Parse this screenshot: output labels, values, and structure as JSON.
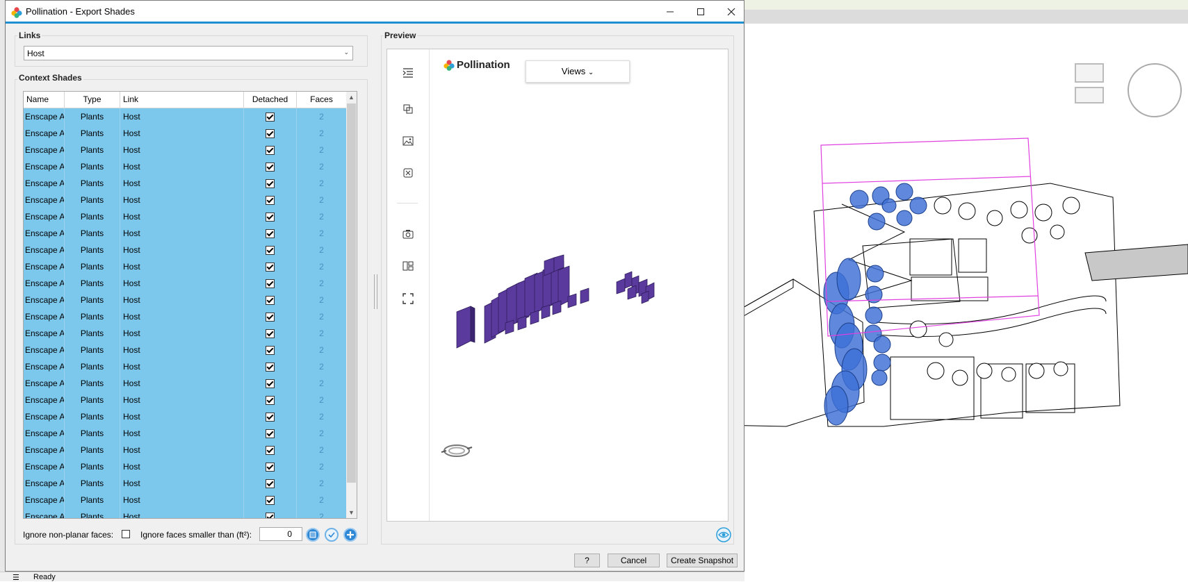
{
  "dialog": {
    "title": "Pollination - Export Shades"
  },
  "links": {
    "legend": "Links",
    "selected": "Host"
  },
  "context": {
    "legend": "Context Shades",
    "columns": [
      "Name",
      "Type",
      "Link",
      "Detached",
      "Faces"
    ],
    "rows": [
      {
        "name": "Enscape A",
        "type": "Plants",
        "link": "Host",
        "faces": "2"
      },
      {
        "name": "Enscape A",
        "type": "Plants",
        "link": "Host",
        "faces": "2"
      },
      {
        "name": "Enscape A",
        "type": "Plants",
        "link": "Host",
        "faces": "2"
      },
      {
        "name": "Enscape A",
        "type": "Plants",
        "link": "Host",
        "faces": "2"
      },
      {
        "name": "Enscape A",
        "type": "Plants",
        "link": "Host",
        "faces": "2"
      },
      {
        "name": "Enscape A",
        "type": "Plants",
        "link": "Host",
        "faces": "2"
      },
      {
        "name": "Enscape A",
        "type": "Plants",
        "link": "Host",
        "faces": "2"
      },
      {
        "name": "Enscape A",
        "type": "Plants",
        "link": "Host",
        "faces": "2"
      },
      {
        "name": "Enscape A",
        "type": "Plants",
        "link": "Host",
        "faces": "2"
      },
      {
        "name": "Enscape A",
        "type": "Plants",
        "link": "Host",
        "faces": "2"
      },
      {
        "name": "Enscape A",
        "type": "Plants",
        "link": "Host",
        "faces": "2"
      },
      {
        "name": "Enscape A",
        "type": "Plants",
        "link": "Host",
        "faces": "2"
      },
      {
        "name": "Enscape A",
        "type": "Plants",
        "link": "Host",
        "faces": "2"
      },
      {
        "name": "Enscape A",
        "type": "Plants",
        "link": "Host",
        "faces": "2"
      },
      {
        "name": "Enscape A",
        "type": "Plants",
        "link": "Host",
        "faces": "2"
      },
      {
        "name": "Enscape A",
        "type": "Plants",
        "link": "Host",
        "faces": "2"
      },
      {
        "name": "Enscape A",
        "type": "Plants",
        "link": "Host",
        "faces": "2"
      },
      {
        "name": "Enscape A",
        "type": "Plants",
        "link": "Host",
        "faces": "2"
      },
      {
        "name": "Enscape A",
        "type": "Plants",
        "link": "Host",
        "faces": "2"
      },
      {
        "name": "Enscape A",
        "type": "Plants",
        "link": "Host",
        "faces": "2"
      },
      {
        "name": "Enscape A",
        "type": "Plants",
        "link": "Host",
        "faces": "2"
      },
      {
        "name": "Enscape A",
        "type": "Plants",
        "link": "Host",
        "faces": "2"
      },
      {
        "name": "Enscape A",
        "type": "Plants",
        "link": "Host",
        "faces": "2"
      },
      {
        "name": "Enscape A",
        "type": "Plants",
        "link": "Host",
        "faces": "2"
      },
      {
        "name": "Enscape A",
        "type": "Plants",
        "link": "Host",
        "faces": "2"
      }
    ],
    "ignore_nonplanar_label": "Ignore non-planar faces:",
    "ignore_smaller_label": "Ignore faces smaller than (ft²):",
    "ignore_smaller_value": "0"
  },
  "preview": {
    "legend": "Preview",
    "brand": "Pollination",
    "views_label": "Views"
  },
  "buttons": {
    "help": "?",
    "cancel": "Cancel",
    "create": "Create Snapshot"
  },
  "status": {
    "text": "Ready"
  },
  "colors": {
    "accent": "#1e8fd1",
    "row_selected": "#7cc7ec",
    "shade_purple": "#5b3a9e",
    "tree_blue": "#3d6fd6"
  }
}
